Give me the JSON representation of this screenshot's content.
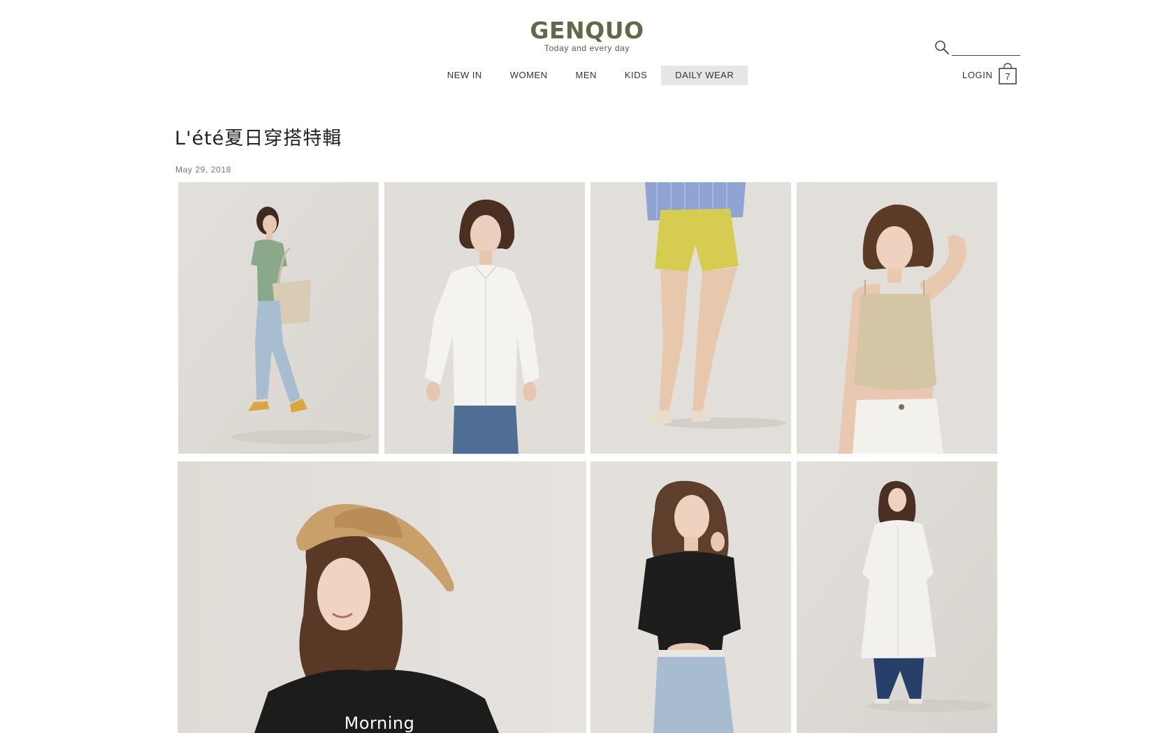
{
  "brand": {
    "name": "GENQUO",
    "tagline": "Today and every day",
    "color": "#5f6b45"
  },
  "nav": {
    "items": [
      {
        "label": "NEW IN"
      },
      {
        "label": "WOMEN"
      },
      {
        "label": "MEN"
      },
      {
        "label": "KIDS"
      },
      {
        "label": "DAILY WEAR",
        "active": true
      }
    ]
  },
  "search": {
    "icon": "search-icon",
    "value": "",
    "placeholder": ""
  },
  "account": {
    "login_label": "LOGIN",
    "cart_icon": "shopping-bag-icon",
    "cart_count": "7"
  },
  "article": {
    "title": "L'été夏日穿搭特輯",
    "date": "May 29, 2018"
  },
  "gallery": {
    "photos": [
      {
        "subject": "model in green tee, light jeans, tote bag, yellow heels"
      },
      {
        "subject": "model in white button-up shirt and jeans"
      },
      {
        "subject": "yellow shorts with blue striped shirt and beige slip-ons"
      },
      {
        "subject": "model in beige camisole and white pants"
      },
      {
        "subject": "model in straw hat and black tee",
        "print_text": "Morning"
      },
      {
        "subject": "model in black top and light denim"
      },
      {
        "subject": "model in long white shirt dress and dark jeans"
      }
    ]
  }
}
